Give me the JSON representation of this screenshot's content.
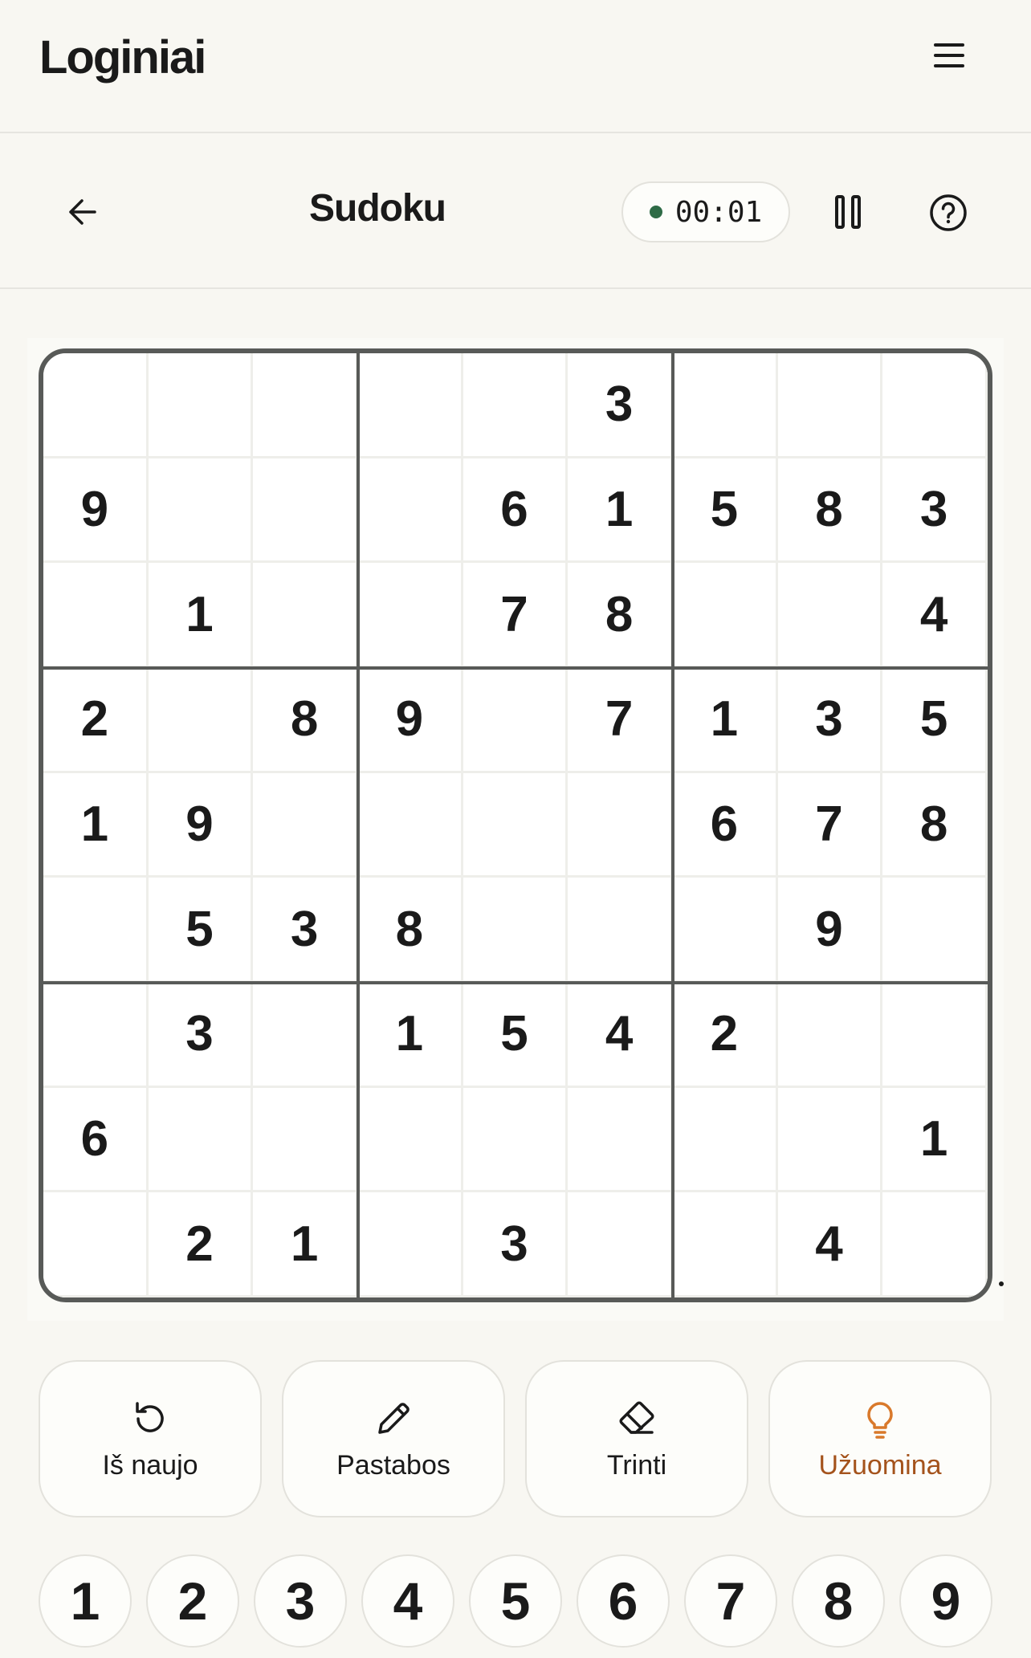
{
  "header": {
    "logo": "Loginiai",
    "menu_icon": "hamburger-icon"
  },
  "game_bar": {
    "back_icon": "arrow-left-icon",
    "title": "Sudoku",
    "timer": "00:01",
    "timer_status_color": "#2e6b46",
    "pause_icon": "pause-icon",
    "help_icon": "question-circle-icon"
  },
  "board": {
    "grid": [
      [
        "",
        "",
        "",
        "",
        "",
        "3",
        "",
        "",
        ""
      ],
      [
        "9",
        "",
        "",
        "",
        "6",
        "1",
        "5",
        "8",
        "3"
      ],
      [
        "",
        "1",
        "",
        "",
        "7",
        "8",
        "",
        "",
        "4"
      ],
      [
        "2",
        "",
        "8",
        "9",
        "",
        "7",
        "1",
        "3",
        "5"
      ],
      [
        "1",
        "9",
        "",
        "",
        "",
        "",
        "6",
        "7",
        "8"
      ],
      [
        "",
        "5",
        "3",
        "8",
        "",
        "",
        "",
        "9",
        ""
      ],
      [
        "",
        "3",
        "",
        "1",
        "5",
        "4",
        "2",
        "",
        ""
      ],
      [
        "6",
        "",
        "",
        "",
        "",
        "",
        "",
        "",
        "1"
      ],
      [
        "",
        "2",
        "1",
        "",
        "3",
        "",
        "",
        "4",
        ""
      ]
    ]
  },
  "actions": {
    "restart": "Iš naujo",
    "notes": "Pastabos",
    "erase": "Trinti",
    "hint": "Užuomina",
    "hint_color": "#d9792b"
  },
  "numpad": [
    "1",
    "2",
    "3",
    "4",
    "5",
    "6",
    "7",
    "8",
    "9"
  ]
}
